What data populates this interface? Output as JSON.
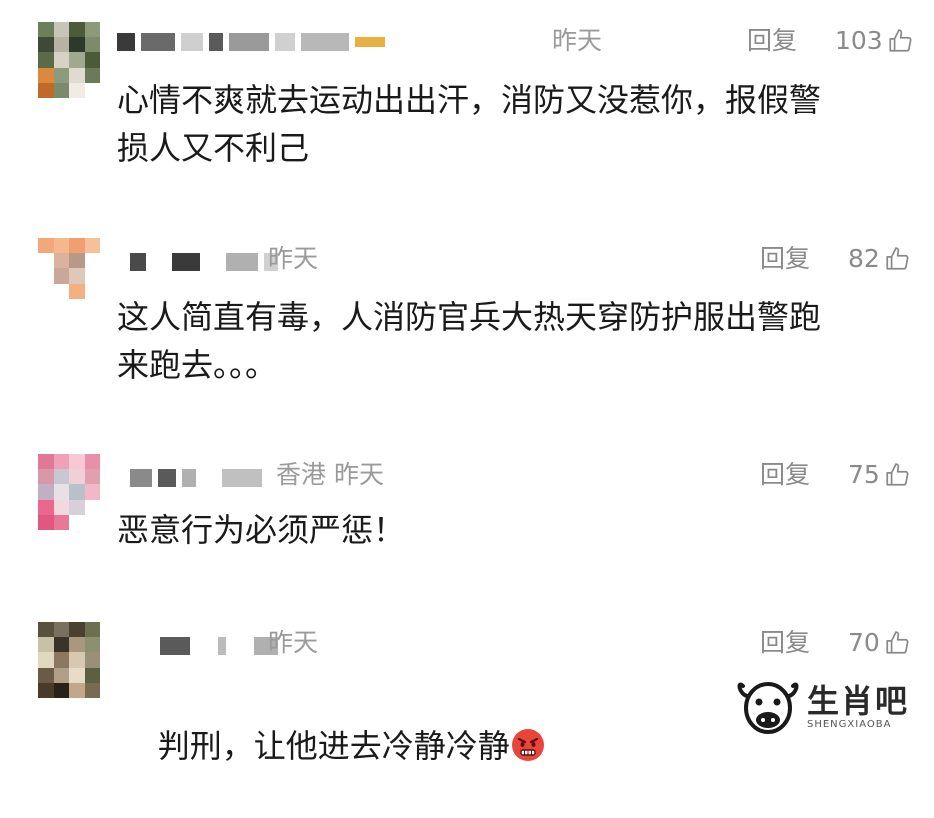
{
  "comments": [
    {
      "location": "",
      "time": "昨天",
      "reply_label": "回复",
      "likes": "103",
      "text": "心情不爽就去运动出出汗，消防又没惹你，报假警\n损人又不利己"
    },
    {
      "location": "",
      "time": "昨天",
      "reply_label": "回复",
      "likes": "82",
      "text": "这人简直有毒，人消防官兵大热天穿防护服出警跑\n来跑去。。。"
    },
    {
      "location": "香港",
      "time": "昨天",
      "reply_label": "回复",
      "likes": "75",
      "text": "恶意行为必须严惩！"
    },
    {
      "location": "",
      "time": "昨天",
      "reply_label": "回复",
      "likes": "70",
      "text": "判刑，让他进去冷静冷静",
      "emoji": "angry-face-emoji"
    }
  ],
  "watermark": {
    "main": "生肖吧",
    "sub": "SHENGXIAOBA"
  },
  "colors": {
    "meta_gray": "#9a9a9a",
    "text_dark": "#1a1a1a",
    "emoji_red": "#e8453c"
  }
}
